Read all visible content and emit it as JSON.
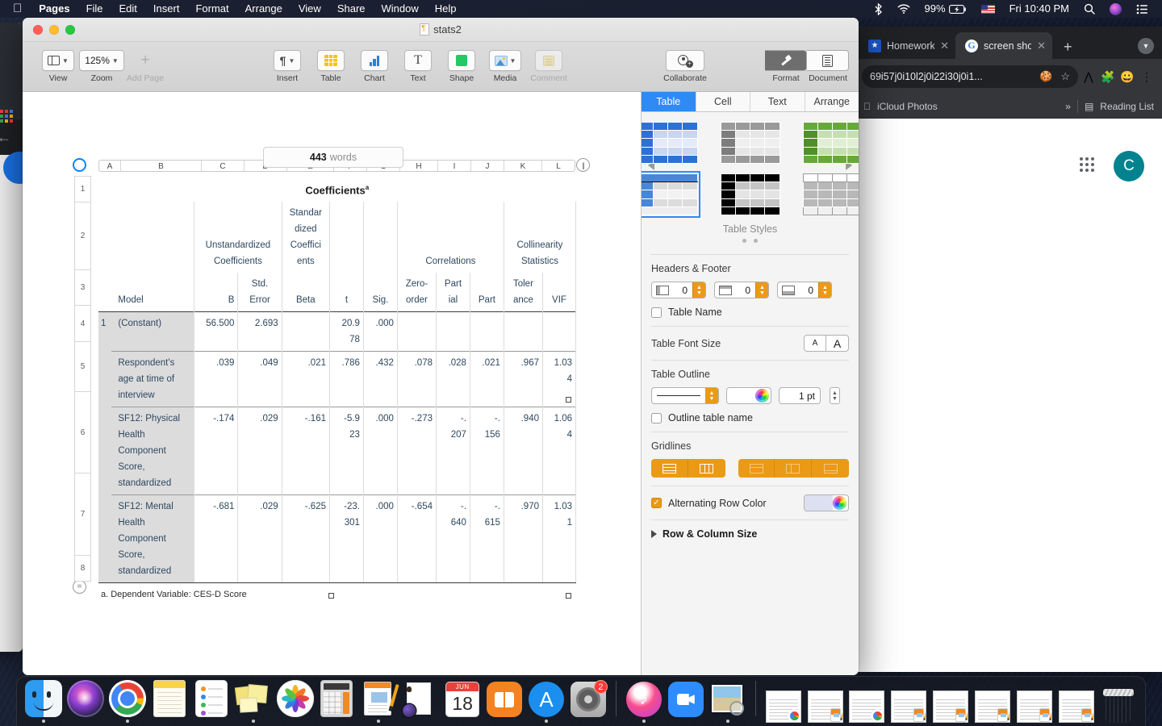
{
  "menubar": {
    "apple": "",
    "items": [
      {
        "label": "Pages",
        "bold": true
      },
      {
        "label": "File",
        "bold": false
      },
      {
        "label": "Edit",
        "bold": false
      },
      {
        "label": "Insert",
        "bold": false
      },
      {
        "label": "Format",
        "bold": false
      },
      {
        "label": "Arrange",
        "bold": false
      },
      {
        "label": "View",
        "bold": false
      },
      {
        "label": "Share",
        "bold": false
      },
      {
        "label": "Window",
        "bold": false
      },
      {
        "label": "Help",
        "bold": false
      }
    ],
    "status": {
      "bluetooth_icon": "bluetooth-icon",
      "wifi_icon": "wifi-icon",
      "battery_percent": "99%",
      "battery_icon": "battery-charging-icon",
      "input_source": "us-flag-icon",
      "clock": "Fri 10:40 PM",
      "search_icon": "search-icon",
      "siri_icon": "siri-icon",
      "control_center_icon": "control-center-icon"
    }
  },
  "pages_window": {
    "document_title": "stats2",
    "toolbar": {
      "view": "View",
      "zoom": "125%",
      "zoom_label": "Zoom",
      "add_page": "Add Page",
      "insert": "Insert",
      "table": "Table",
      "chart": "Chart",
      "text": "Text",
      "shape": "Shape",
      "media": "Media",
      "comment": "Comment",
      "collaborate": "Collaborate",
      "format": "Format",
      "document": "Document"
    },
    "word_count": {
      "count": "443",
      "unit": "words"
    },
    "canvas": {
      "column_headers": [
        "A",
        "B",
        "C",
        "D",
        "E",
        "F",
        "G",
        "H",
        "I",
        "J",
        "K",
        "L"
      ],
      "row_headers": [
        "1",
        "2",
        "3",
        "4",
        "5",
        "6",
        "7",
        "8"
      ]
    }
  },
  "spss_table": {
    "title": "Coefficients",
    "title_superscript": "a",
    "group_headers": {
      "unstandardized": "Unstandardized\nCoefficients",
      "standardized": "Standardized Coefficients",
      "correlations": "Correlations",
      "collinearity": "Collinearity Statistics"
    },
    "header_lines": {
      "unstd_1": "Unstandardized",
      "unstd_2": "Coefficients",
      "std_1": "Standar",
      "std_2": "dized",
      "std_3": "Coeffici",
      "std_4": "ents",
      "corr": "Correlations",
      "coll_1": "Collinearity",
      "coll_2": "Statistics"
    },
    "column_headers": {
      "model": "Model",
      "b": "B",
      "std_error_1": "Std.",
      "std_error_2": "Error",
      "beta": "Beta",
      "t": "t",
      "sig": "Sig.",
      "zero_order_1": "Zero-",
      "zero_order_2": "order",
      "partial_1": "Part",
      "partial_2": "ial",
      "part": "Part",
      "tolerance_1": "Toler",
      "tolerance_2": "ance",
      "vif": "VIF"
    },
    "model_number": "1",
    "rows": [
      {
        "label": "(Constant)",
        "b": "56.500",
        "std_error": "2.693",
        "beta": "",
        "t_1": "20.9",
        "t_2": "78",
        "sig": ".000",
        "zero_order": "",
        "partial_1": "",
        "partial_2": "",
        "part_1": "",
        "part_2": "",
        "tolerance": "",
        "vif_1": "",
        "vif_2": ""
      },
      {
        "label": "Respondent's age at time of interview",
        "label_lines": [
          "Respondent's",
          "age at time of",
          "interview"
        ],
        "b": ".039",
        "std_error": ".049",
        "beta": ".021",
        "t_1": ".786",
        "t_2": "",
        "sig": ".432",
        "zero_order": ".078",
        "partial_1": ".028",
        "partial_2": "",
        "part_1": ".021",
        "part_2": "",
        "tolerance": ".967",
        "vif_1": "1.03",
        "vif_2": "4"
      },
      {
        "label": "SF12: Physical Health Component Score, standardized",
        "label_lines": [
          "SF12: Physical",
          "Health",
          "Component",
          "Score,",
          "standardized"
        ],
        "b": "-.174",
        "std_error": ".029",
        "beta": "-.161",
        "t_1": "-5.9",
        "t_2": "23",
        "sig": ".000",
        "zero_order": "-.273",
        "partial_1": "-.",
        "partial_2": "207",
        "part_1": "-.",
        "part_2": "156",
        "tolerance": ".940",
        "vif_1": "1.06",
        "vif_2": "4"
      },
      {
        "label": "SF12: Mental Health Component Score, standardized",
        "label_lines": [
          "SF12: Mental",
          "Health",
          "Component",
          "Score,",
          "standardized"
        ],
        "b": "-.681",
        "std_error": ".029",
        "beta": "-.625",
        "t_1": "-23.",
        "t_2": "301",
        "sig": ".000",
        "zero_order": "-.654",
        "partial_1": "-.",
        "partial_2": "640",
        "part_1": "-.",
        "part_2": "615",
        "tolerance": ".970",
        "vif_1": "1.03",
        "vif_2": "1"
      }
    ],
    "footnote": "a. Dependent Variable: CES-D Score"
  },
  "inspector": {
    "tabs": [
      {
        "label": "Table",
        "active": true
      },
      {
        "label": "Cell",
        "active": false
      },
      {
        "label": "Text",
        "active": false
      },
      {
        "label": "Arrange",
        "active": false
      }
    ],
    "styles_caption": "Table Styles",
    "styles": [
      {
        "name": "blue-basic",
        "header": "#2d72d2",
        "band_a": "#c8d6ef",
        "band_b": "#e4eaf7",
        "side": "#2d72d2",
        "footer": "#2d72d2",
        "selected": false
      },
      {
        "name": "gray-basic",
        "header": "#9a9a9a",
        "band_a": "#e0e0e0",
        "band_b": "#efefef",
        "side": "#7d7d7d",
        "footer": "#9a9a9a",
        "selected": false
      },
      {
        "name": "green-basic",
        "header": "#66a83a",
        "band_a": "#c6dfb0",
        "band_b": "#e0efd4",
        "side": "#4f9128",
        "footer": "#66a83a",
        "selected": false
      },
      {
        "name": "blue-outline",
        "header": "#4a86d8",
        "band_a": "#d8d8d8",
        "band_b": "#efefef",
        "side": "#4a86d8",
        "footer": "#e8e8e8",
        "selected": true
      },
      {
        "name": "black-basic",
        "header": "#000000",
        "band_a": "#c4c4c4",
        "band_b": "#e4e4e4",
        "side": "#000000",
        "footer": "#000000",
        "selected": false
      },
      {
        "name": "gray-plain",
        "header": "#ffffff",
        "band_a": "#b8b8b8",
        "band_b": "#b8b8b8",
        "side": "#b8b8b8",
        "footer": "#f0f0f0",
        "selected": false
      }
    ],
    "headers_footer": {
      "title": "Headers & Footer",
      "header_rows": "0",
      "header_columns": "0",
      "footer_rows": "0",
      "table_name_label": "Table Name",
      "table_name_checked": false
    },
    "font_size": {
      "title": "Table Font Size",
      "decrease": "A",
      "increase": "A"
    },
    "table_outline": {
      "title": "Table Outline",
      "width": "1 pt",
      "outline_table_name_label": "Outline table name",
      "outline_table_name_checked": false
    },
    "gridlines": {
      "title": "Gridlines"
    },
    "alternating": {
      "label": "Alternating Row Color",
      "checked": true,
      "color": "#dde0f0"
    },
    "row_column_size": "Row & Column Size"
  },
  "chrome": {
    "tabs": [
      {
        "title": "Homework",
        "active": false,
        "favicon": "bookmark-star-icon"
      },
      {
        "title": "screen sho",
        "active": true,
        "favicon": "google-icon"
      }
    ],
    "new_tab": "+",
    "url": "69i57j0i10l2j0i22i30j0i1...",
    "bookmarks": [
      {
        "label": "iCloud Photos",
        "icon": "apple-icon"
      }
    ],
    "overflow": "»",
    "reading_list": "Reading List",
    "avatar_letter": "C"
  },
  "dock": {
    "items": [
      {
        "name": "finder",
        "label": "Finder",
        "running": true
      },
      {
        "name": "siri",
        "label": "Siri",
        "running": false
      },
      {
        "name": "chrome",
        "label": "Google Chrome",
        "running": true
      },
      {
        "name": "notes",
        "label": "Notes",
        "running": false
      },
      {
        "name": "reminders",
        "label": "Reminders",
        "running": false
      },
      {
        "name": "stickies",
        "label": "Stickies",
        "running": true
      },
      {
        "name": "photos",
        "label": "Photos",
        "running": false
      },
      {
        "name": "calculator",
        "label": "Calculator",
        "running": false
      },
      {
        "name": "pages",
        "label": "Pages",
        "running": true
      },
      {
        "name": "photo-booth",
        "label": "Photo Booth",
        "running": false
      },
      {
        "name": "calendar",
        "label": "Calendar",
        "month": "JUN",
        "day": "18",
        "running": false
      },
      {
        "name": "books",
        "label": "Books",
        "running": false
      },
      {
        "name": "app-store",
        "label": "App Store",
        "running": true
      },
      {
        "name": "system-preferences",
        "label": "System Preferences",
        "badge": "2",
        "running": false
      },
      {
        "name": "itunes",
        "label": "iTunes",
        "running": true
      },
      {
        "name": "zoom",
        "label": "Zoom",
        "running": false
      },
      {
        "name": "preview",
        "label": "Preview",
        "running": true
      }
    ],
    "minimized_count": 8,
    "trash": "Trash"
  }
}
